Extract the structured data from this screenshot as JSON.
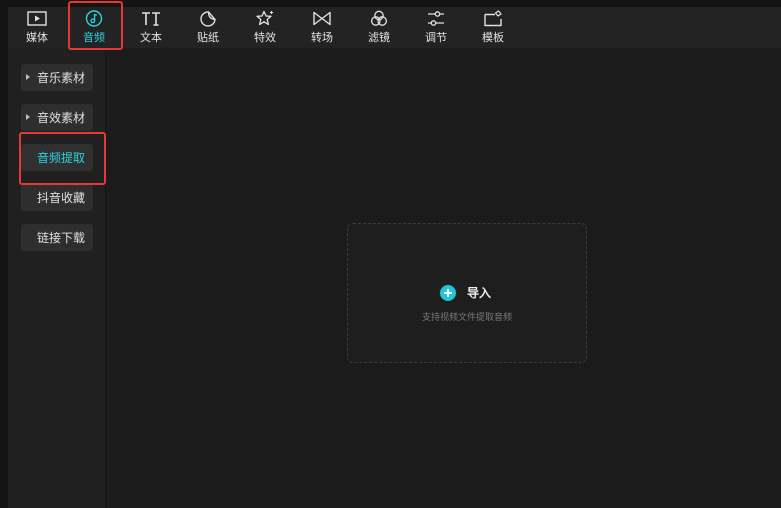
{
  "toolbar": {
    "tabs": [
      {
        "label": "媒体",
        "icon": "media-icon"
      },
      {
        "label": "音频",
        "icon": "audio-icon",
        "active": true
      },
      {
        "label": "文本",
        "icon": "text-icon"
      },
      {
        "label": "贴纸",
        "icon": "sticker-icon"
      },
      {
        "label": "特效",
        "icon": "effects-icon"
      },
      {
        "label": "转场",
        "icon": "transition-icon"
      },
      {
        "label": "滤镜",
        "icon": "filter-icon"
      },
      {
        "label": "调节",
        "icon": "adjust-icon"
      },
      {
        "label": "模板",
        "icon": "template-icon"
      }
    ]
  },
  "sidebar": {
    "items": [
      {
        "label": "音乐素材",
        "has_arrow": true
      },
      {
        "label": "音效素材",
        "has_arrow": true
      },
      {
        "label": "音频提取",
        "selected": true
      },
      {
        "label": "抖音收藏"
      },
      {
        "label": "链接下载"
      }
    ]
  },
  "main": {
    "import_label": "导入",
    "import_hint": "支持视频文件提取音频"
  },
  "colors": {
    "accent": "#2ad4e0",
    "import_button": "#1ec8d8",
    "highlight_border": "#e53935",
    "background": "#1b1b1b"
  }
}
